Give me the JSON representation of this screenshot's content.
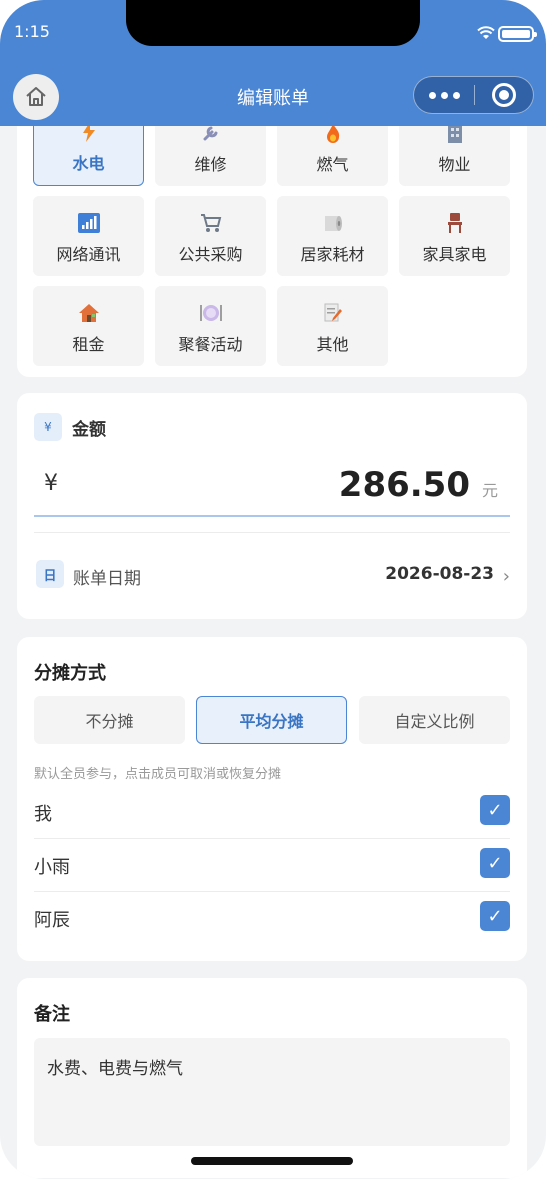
{
  "status_bar": {
    "time": "1:15"
  },
  "nav": {
    "title": "编辑账单"
  },
  "categories": [
    {
      "label": "水电",
      "icon": "lightning-icon",
      "active": true
    },
    {
      "label": "维修",
      "icon": "wrench-icon",
      "active": false
    },
    {
      "label": "燃气",
      "icon": "flame-icon",
      "active": false
    },
    {
      "label": "物业",
      "icon": "building-icon",
      "active": false
    },
    {
      "label": "网络通讯",
      "icon": "signal-bars-icon",
      "active": false
    },
    {
      "label": "公共采购",
      "icon": "shopping-cart-icon",
      "active": false
    },
    {
      "label": "居家耗材",
      "icon": "toilet-paper-icon",
      "active": false
    },
    {
      "label": "家具家电",
      "icon": "chair-icon",
      "active": false
    },
    {
      "label": "租金",
      "icon": "house-icon",
      "active": false
    },
    {
      "label": "聚餐活动",
      "icon": "dining-plate-icon",
      "active": false
    },
    {
      "label": "其他",
      "icon": "memo-icon",
      "active": false
    }
  ],
  "amount": {
    "badge": "¥",
    "label": "金额",
    "currency": "¥",
    "value": "286.50",
    "unit": "元"
  },
  "date": {
    "badge": "日",
    "label": "账单日期",
    "value": "2026-08-23",
    "chevron": "›"
  },
  "split": {
    "title": "分摊方式",
    "tabs": [
      {
        "label": "不分摊",
        "active": false
      },
      {
        "label": "平均分摊",
        "active": true
      },
      {
        "label": "自定义比例",
        "active": false
      }
    ],
    "hint": "默认全员参与，点击成员可取消或恢复分摊",
    "members": [
      {
        "name": "我",
        "checked": true
      },
      {
        "name": "小雨",
        "checked": true
      },
      {
        "name": "阿辰",
        "checked": true
      }
    ],
    "check_mark": "✓"
  },
  "note": {
    "title": "备注",
    "value": "水费、电费与燃气"
  },
  "colors": {
    "primary": "#4a86d4",
    "card": "#ffffff",
    "background": "#f2f3f5"
  }
}
